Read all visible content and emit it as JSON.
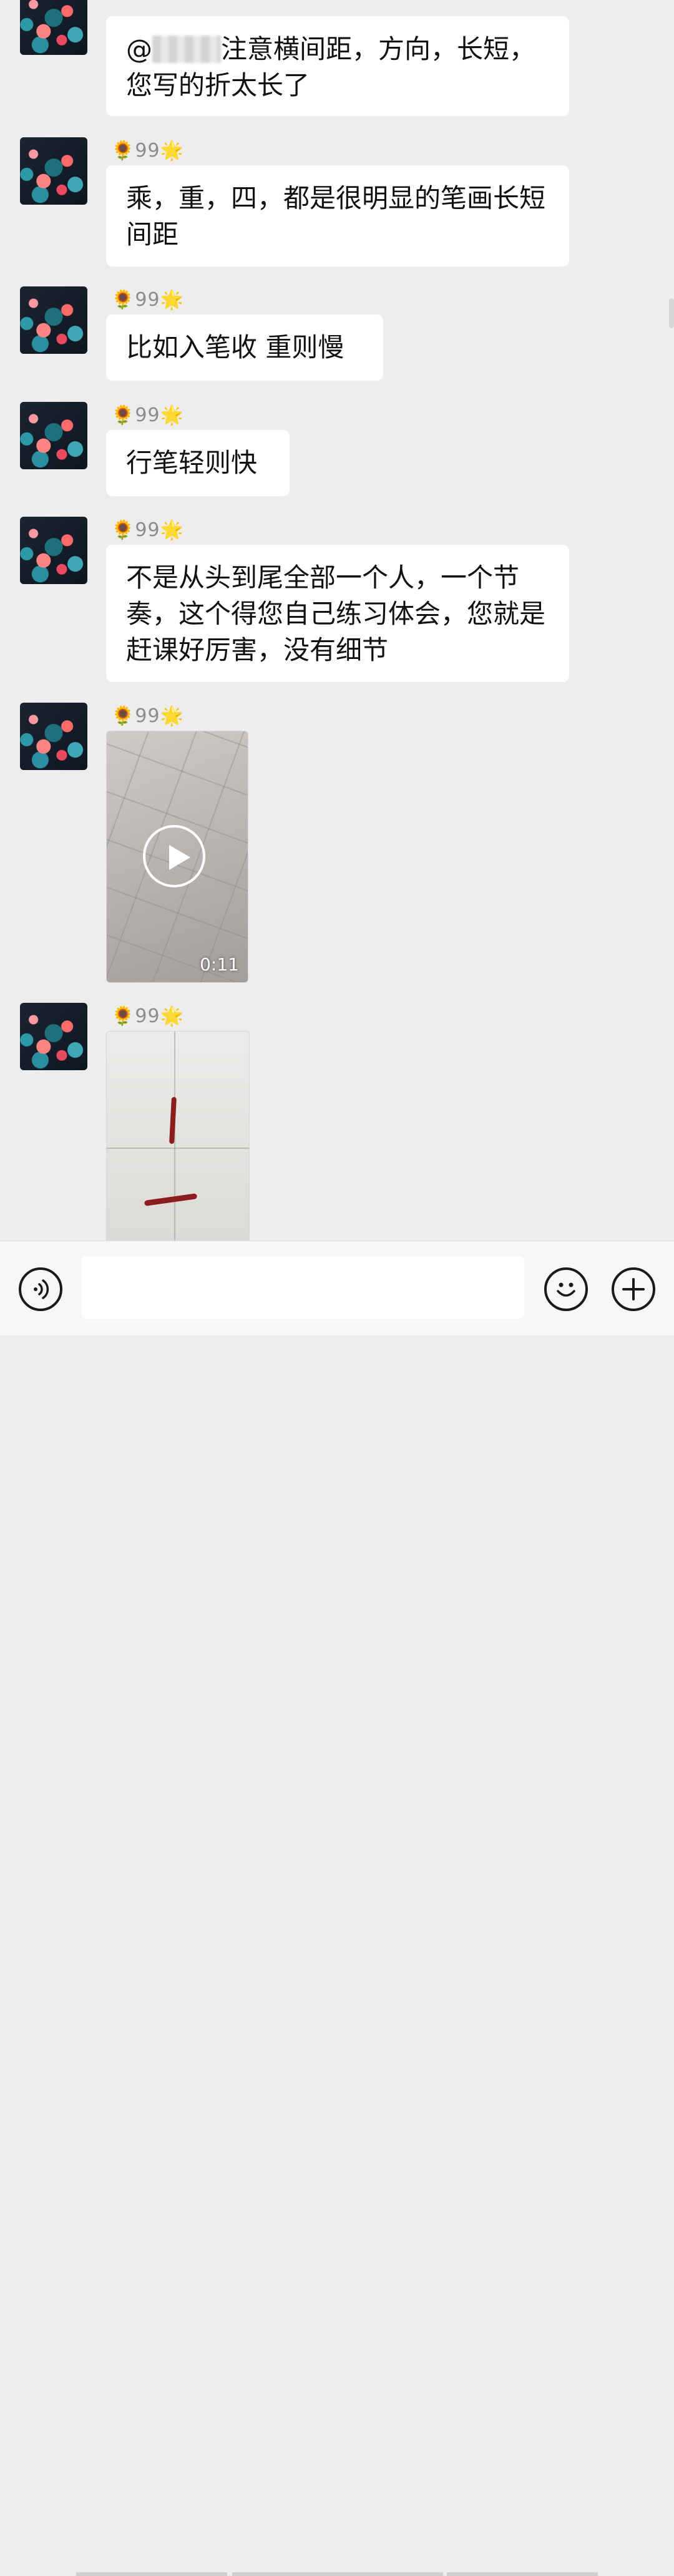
{
  "messages": [
    {
      "sender": "",
      "text_prefix": "@",
      "text_suffix": "注意横间距，方向，长短，您写的折太长了"
    },
    {
      "sender": "99",
      "text": "乘，重，四，都是很明显的笔画长短间距"
    },
    {
      "sender": "99",
      "text": "比如入笔收 重则慢"
    },
    {
      "sender": "99",
      "text": "行笔轻则快"
    },
    {
      "sender": "99",
      "text": "不是从头到尾全部一个人，一个节奏，这个得您自己练习体会，您就是赶课好厉害，没有细节"
    },
    {
      "sender": "99",
      "video_duration": "0:11"
    },
    {
      "sender": "99"
    }
  ],
  "icons": {
    "sender_prefix": "🌻",
    "sender_suffix": "🌟",
    "voice": "voice-icon",
    "emoji": "emoji-icon",
    "plus": "plus-icon",
    "play": "play-icon"
  },
  "input": {
    "value": "",
    "placeholder": ""
  },
  "colors": {
    "background": "#ededed",
    "bubble": "#ffffff",
    "toolbar": "#f7f7f7"
  }
}
